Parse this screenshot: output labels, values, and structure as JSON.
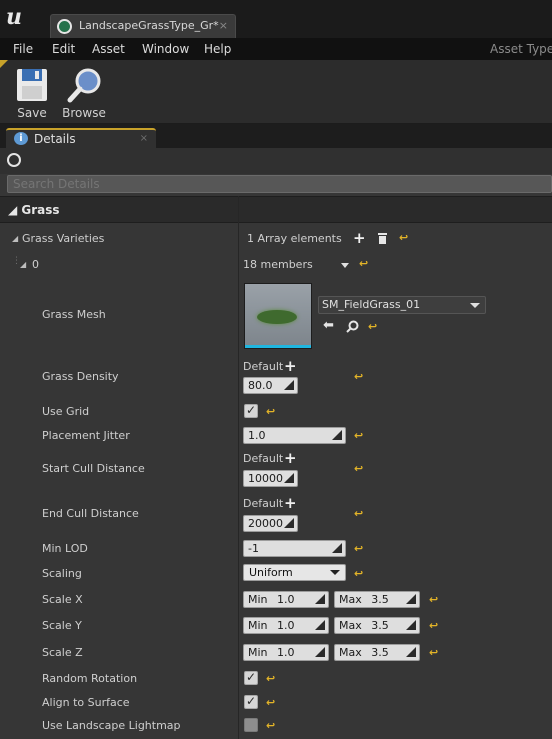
{
  "window": {
    "tab_title": "LandscapeGrassType_Gr*",
    "tab_close": "×"
  },
  "menu": {
    "items": [
      "File",
      "Edit",
      "Asset",
      "Window",
      "Help"
    ],
    "asset_type_label": "Asset Type:"
  },
  "toolbar": {
    "save_label": "Save",
    "browse_label": "Browse"
  },
  "details_tab": {
    "label": "Details",
    "close": "×"
  },
  "search": {
    "placeholder": "Search Details"
  },
  "category": {
    "label": "Grass"
  },
  "grass_varieties": {
    "label": "Grass Varieties",
    "summary": "1 Array elements",
    "element_index": "0",
    "members": "18 members"
  },
  "properties": {
    "grass_mesh": {
      "label": "Grass Mesh",
      "value": "SM_FieldGrass_01"
    },
    "grass_density": {
      "label": "Grass Density",
      "default_label": "Default",
      "value": "80.0"
    },
    "use_grid": {
      "label": "Use Grid",
      "checked": true
    },
    "placement_jitter": {
      "label": "Placement Jitter",
      "value": "1.0"
    },
    "start_cull_distance": {
      "label": "Start Cull Distance",
      "default_label": "Default",
      "value": "10000"
    },
    "end_cull_distance": {
      "label": "End Cull Distance",
      "default_label": "Default",
      "value": "20000"
    },
    "min_lod": {
      "label": "Min LOD",
      "value": "-1"
    },
    "scaling": {
      "label": "Scaling",
      "value": "Uniform"
    },
    "scale_x": {
      "label": "Scale X",
      "min_label": "Min",
      "min": "1.0",
      "max_label": "Max",
      "max": "3.5"
    },
    "scale_y": {
      "label": "Scale Y",
      "min_label": "Min",
      "min": "1.0",
      "max_label": "Max",
      "max": "3.5"
    },
    "scale_z": {
      "label": "Scale Z",
      "min_label": "Min",
      "min": "1.0",
      "max_label": "Max",
      "max": "3.5"
    },
    "random_rotation": {
      "label": "Random Rotation",
      "checked": true
    },
    "align_to_surface": {
      "label": "Align to Surface",
      "checked": true
    },
    "use_landscape_lightmap": {
      "label": "Use Landscape Lightmap",
      "checked": false
    }
  },
  "colors": {
    "accent": "#c8a22a",
    "reset_arrow": "#e3b428",
    "thumbnail_bar": "#1fb6e0"
  }
}
